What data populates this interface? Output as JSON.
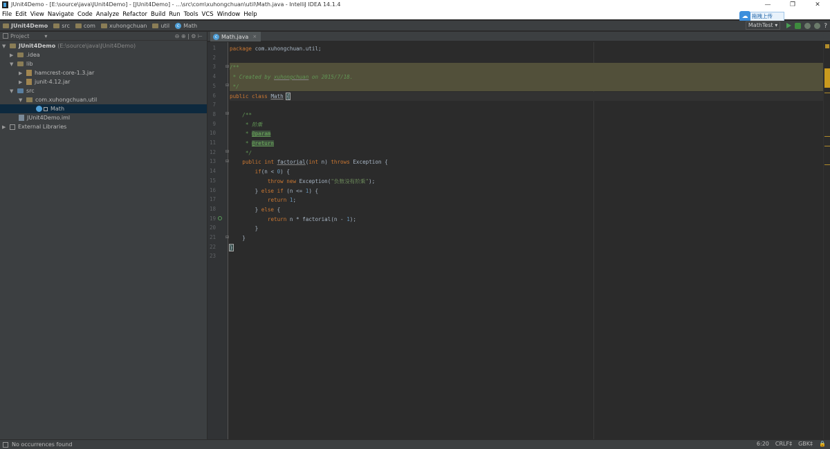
{
  "window": {
    "title": "JUnit4Demo - [E:\\source\\java\\JUnit4Demo] - [JUnit4Demo] - ...\\src\\com\\xuhongchuan\\util\\Math.java - IntelliJ IDEA 14.1.4",
    "controls": [
      "—",
      "❐",
      "✕"
    ]
  },
  "menu": [
    "File",
    "Edit",
    "View",
    "Navigate",
    "Code",
    "Analyze",
    "Refactor",
    "Build",
    "Run",
    "Tools",
    "VCS",
    "Window",
    "Help"
  ],
  "upload_button": "拖拽上传",
  "breadcrumb": [
    "JUnit4Demo",
    "src",
    "com",
    "xuhongchuan",
    "util",
    "Math"
  ],
  "run_config": "MathTest ▾",
  "project": {
    "header": "Project",
    "view_toggle": "▾",
    "tree": [
      {
        "label": "JUnit4Demo",
        "path": "(E:\\source\\java\\JUnit4Demo)",
        "arrow": "▼",
        "icon": "module-folder-icon"
      },
      {
        "label": ".idea",
        "arrow": "▶",
        "icon": "folder-icon"
      },
      {
        "label": "lib",
        "arrow": "▼",
        "icon": "folder-icon"
      },
      {
        "label": "hamcrest-core-1.3.jar",
        "arrow": "▶",
        "icon": "jar-icon"
      },
      {
        "label": "junit-4.12.jar",
        "arrow": "▶",
        "icon": "jar-icon"
      },
      {
        "label": "src",
        "arrow": "▼",
        "icon": "source-folder-icon"
      },
      {
        "label": "com.xuhongchuan.util",
        "arrow": "▼",
        "icon": "package-icon"
      },
      {
        "label": "Math",
        "arrow": "",
        "icon": "class-icon"
      },
      {
        "label": "JUnit4Demo.iml",
        "arrow": "",
        "icon": "iml-file-icon"
      },
      {
        "label": "External Libraries",
        "arrow": "▶",
        "icon": "library-icon"
      }
    ]
  },
  "editor": {
    "tab": "Math.java",
    "tab_close": "×",
    "line_numbers": [
      "1",
      "2",
      "3",
      "4",
      "5",
      "6",
      "7",
      "8",
      "9",
      "10",
      "11",
      "12",
      "13",
      "14",
      "15",
      "16",
      "17",
      "18",
      "19",
      "20",
      "21",
      "22",
      "23"
    ]
  },
  "status": {
    "message": "No occurrences found",
    "position": "6:20",
    "line_sep": "CRLF‡",
    "encoding": "GBK‡"
  },
  "colors": {
    "background": "#2b2b2b",
    "keyword": "#cc7832",
    "comment": "#629755",
    "string": "#6a8759",
    "number": "#6897bb",
    "highlight": "#52503a"
  }
}
